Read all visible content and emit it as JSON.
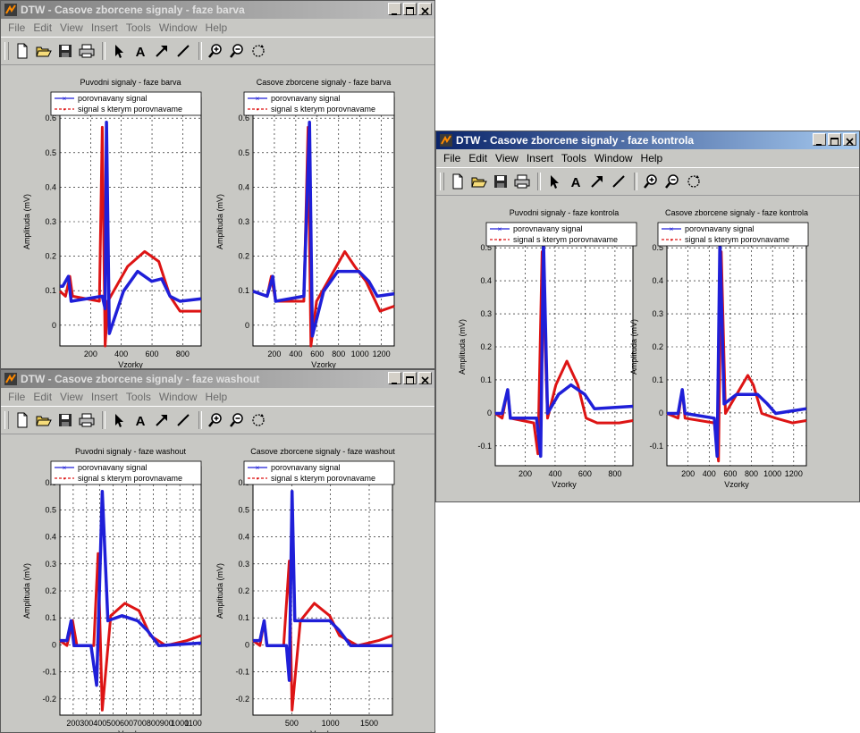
{
  "menu_items": [
    "File",
    "Edit",
    "View",
    "Insert",
    "Tools",
    "Window",
    "Help"
  ],
  "legend_labels": [
    "porovnavany signal",
    "signal s kterym porovnavame"
  ],
  "colors": {
    "series_blue": "#1f1fd8",
    "series_red": "#dd1414",
    "title_active": "#0a246a",
    "title_inactive": "#808080",
    "window_bg": "#c8c8c4"
  },
  "icons": [
    "new-file-icon",
    "open-folder-icon",
    "save-icon",
    "print-icon",
    "arrow-cursor-icon",
    "text-insert-icon",
    "arrow-insert-icon",
    "line-insert-icon",
    "zoom-in-icon",
    "zoom-out-icon",
    "rotate-icon"
  ],
  "windows": [
    {
      "id": "barva",
      "title": "DTW - Casove zborcene signaly - faze barva",
      "active": false,
      "plots": [
        {
          "title": "Puvodni signaly - faze barva",
          "xlabel": "Vzorky",
          "ylabel": "Amplituda (mV)",
          "xticks": [
            "200",
            "400",
            "600",
            "800"
          ],
          "yticks": [
            "0",
            "0.1",
            "0.2",
            "0.3",
            "0.4",
            "0.5",
            "0.6"
          ]
        },
        {
          "title": "Casove zborcene signaly - faze barva",
          "xlabel": "Vzorky",
          "ylabel": "Amplituda (mV)",
          "xticks": [
            "200",
            "400",
            "600",
            "800",
            "1000",
            "1200"
          ],
          "yticks": [
            "0",
            "0.1",
            "0.2",
            "0.3",
            "0.4",
            "0.5",
            "0.6"
          ]
        }
      ]
    },
    {
      "id": "washout",
      "title": "DTW - Casove zborcene signaly - faze washout",
      "active": false,
      "plots": [
        {
          "title": "Puvodni signaly - faze washout",
          "xlabel": "Vzorky",
          "ylabel": "Amplituda (mV)",
          "xticks": [
            "200",
            "300",
            "400",
            "500",
            "600",
            "700",
            "800",
            "900",
            "1000",
            "1100"
          ],
          "yticks": [
            "-0.2",
            "-0.1",
            "0",
            "0.1",
            "0.2",
            "0.3",
            "0.4",
            "0.5",
            "0.6"
          ]
        },
        {
          "title": "Casove zborcene signaly - faze washout",
          "xlabel": "Vzorky",
          "ylabel": "Amplituda (mV)",
          "xticks": [
            "500",
            "1000",
            "1500"
          ],
          "yticks": [
            "-0.2",
            "-0.1",
            "0",
            "0.1",
            "0.2",
            "0.3",
            "0.4",
            "0.5",
            "0.6"
          ]
        }
      ]
    },
    {
      "id": "kontrola",
      "title": "DTW - Casove zborcene signaly - faze kontrola",
      "active": true,
      "plots": [
        {
          "title": "Puvodni signaly - faze kontrola",
          "xlabel": "Vzorky",
          "ylabel": "Amplituda (mV)",
          "xticks": [
            "200",
            "400",
            "600",
            "800"
          ],
          "yticks": [
            "-0.1",
            "0",
            "0.1",
            "0.2",
            "0.3",
            "0.4",
            "0.5"
          ]
        },
        {
          "title": "Casove zborcene signaly - faze kontrola",
          "xlabel": "Vzorky",
          "ylabel": "Amplituda (mV)",
          "xticks": [
            "200",
            "400",
            "600",
            "800",
            "1000",
            "1200"
          ],
          "yticks": [
            "-0.1",
            "0",
            "0.1",
            "0.2",
            "0.3",
            "0.4",
            "0.5"
          ]
        }
      ]
    }
  ]
}
